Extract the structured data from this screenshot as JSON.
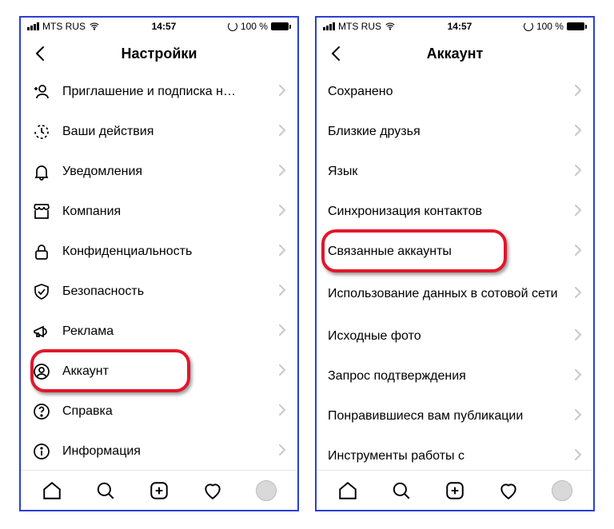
{
  "status": {
    "carrier": "MTS RUS",
    "time": "14:57",
    "battery_text": "100 %"
  },
  "left": {
    "title": "Настройки",
    "items": [
      {
        "label": "Приглашение и подписка н…",
        "icon": "user-plus"
      },
      {
        "label": "Ваши действия",
        "icon": "clock-history"
      },
      {
        "label": "Уведомления",
        "icon": "bell"
      },
      {
        "label": "Компания",
        "icon": "storefront"
      },
      {
        "label": "Конфиденциальность",
        "icon": "lock"
      },
      {
        "label": "Безопасность",
        "icon": "shield-check"
      },
      {
        "label": "Реклама",
        "icon": "megaphone"
      },
      {
        "label": "Аккаунт",
        "icon": "user-circle"
      },
      {
        "label": "Справка",
        "icon": "help"
      },
      {
        "label": "Информация",
        "icon": "info"
      }
    ],
    "highlight_index": 7
  },
  "right": {
    "title": "Аккаунт",
    "items": [
      {
        "label": "Сохранено"
      },
      {
        "label": "Близкие друзья"
      },
      {
        "label": "Язык"
      },
      {
        "label": "Синхронизация контактов"
      },
      {
        "label": "Связанные аккаунты"
      },
      {
        "label": "Использование данных в сотовой сети",
        "two": true
      },
      {
        "label": "Исходные фото"
      },
      {
        "label": "Запрос подтверждения"
      },
      {
        "label": "Понравившиеся вам публикации"
      },
      {
        "label": "Инструменты работы с"
      }
    ],
    "highlight_index": 4
  }
}
